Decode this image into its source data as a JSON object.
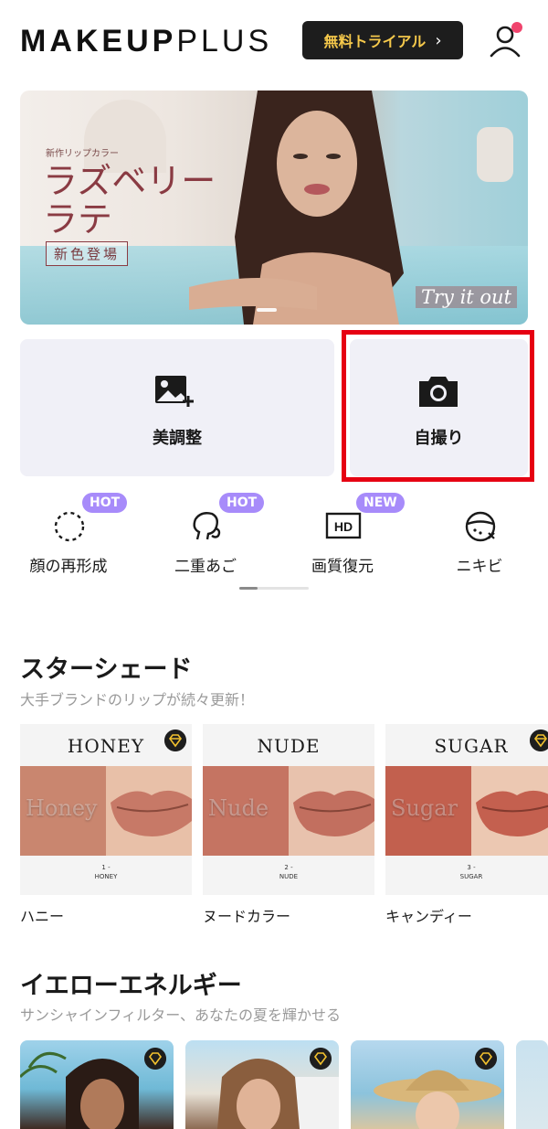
{
  "header": {
    "logo_bold": "MAKEUP",
    "logo_light": "PLUS",
    "trial_label": "無料トライアル",
    "trial_chevron": "›",
    "user_icon": "user-icon"
  },
  "banner": {
    "subtitle": "新作リップカラー",
    "title": "ラズベリーラテ",
    "tag": "新色登場",
    "cta": "Try it out"
  },
  "actions": {
    "retouch_label": "美調整",
    "retouch_icon": "image-add-icon",
    "selfie_label": "自撮り",
    "selfie_icon": "camera-icon"
  },
  "tools": [
    {
      "label": "顔の再形成",
      "badge": "HOT",
      "icon": "face-outline-icon"
    },
    {
      "label": "二重あご",
      "badge": "HOT",
      "icon": "head-profile-icon"
    },
    {
      "label": "画質復元",
      "badge": "NEW",
      "icon": "hd-icon"
    },
    {
      "label": "ニキビ",
      "badge": "",
      "icon": "acne-face-icon"
    }
  ],
  "sections": {
    "star_shade_title": "スターシェード",
    "star_shade_sub": "大手ブランドのリップが続々更新！",
    "yellow_title": "イエローエネルギー",
    "yellow_sub": "サンシャインフィルター、あなたの夏を輝かせる"
  },
  "shades": [
    {
      "name": "HONEY",
      "swatch_text": "Honey",
      "num": "1 -",
      "code": "HONEY",
      "label": "ハニー",
      "swatch": "#c9866f",
      "lip": "#c77967"
    },
    {
      "name": "NUDE",
      "swatch_text": "Nude",
      "num": "2 -",
      "code": "NUDE",
      "label": "ヌードカラー",
      "swatch": "#c57462",
      "lip": "#c26f5f"
    },
    {
      "name": "SUGAR",
      "swatch_text": "Sugar",
      "num": "3 -",
      "code": "SUGAR",
      "label": "キャンディー",
      "swatch": "#c2604e",
      "lip": "#c4604f"
    }
  ],
  "colors": {
    "accent_gold": "#f6c94b",
    "highlight_red": "#e60012",
    "badge_purple": "#a78bfa",
    "notification_pink": "#f0446d",
    "premium_gem": "#f2c12e"
  }
}
